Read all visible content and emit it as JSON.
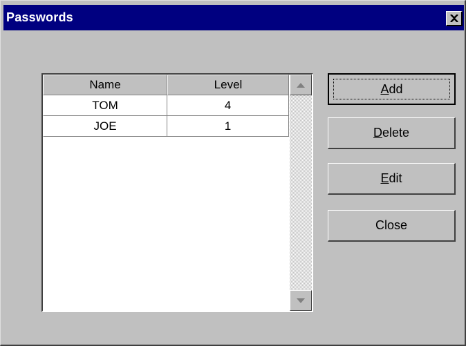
{
  "window": {
    "title": "Passwords",
    "title_bar_color": "#000080",
    "close_icon": "close-x-icon"
  },
  "table": {
    "headers": [
      "Name",
      "Level"
    ],
    "rows": [
      {
        "name": "TOM",
        "level": "4"
      },
      {
        "name": "JOE",
        "level": "1"
      }
    ]
  },
  "scrollbar": {
    "up_icon": "scroll-up-arrow-icon",
    "down_icon": "scroll-down-arrow-icon"
  },
  "buttons": {
    "add": {
      "mnemonic": "A",
      "rest": "dd"
    },
    "delete": {
      "mnemonic": "D",
      "rest": "elete"
    },
    "edit": {
      "mnemonic": "E",
      "rest": "dit"
    },
    "close": {
      "label": "Close"
    }
  }
}
